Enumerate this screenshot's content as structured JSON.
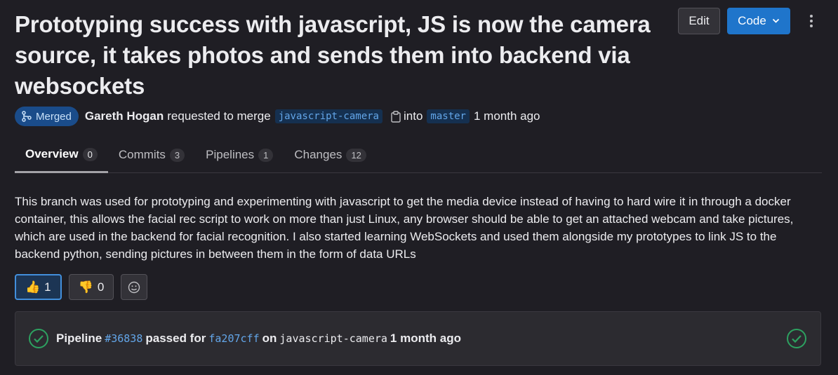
{
  "header": {
    "title": "Prototyping success with javascript, JS is now the camera source, it takes photos and sends them into backend via websockets",
    "edit_label": "Edit",
    "code_label": "Code"
  },
  "meta": {
    "status": "Merged",
    "author": "Gareth Hogan",
    "action_text": "requested to merge",
    "source_branch": "javascript-camera",
    "into_text": "into",
    "target_branch": "master",
    "time": "1 month ago"
  },
  "tabs": [
    {
      "label": "Overview",
      "count": "0",
      "active": true
    },
    {
      "label": "Commits",
      "count": "3"
    },
    {
      "label": "Pipelines",
      "count": "1"
    },
    {
      "label": "Changes",
      "count": "12"
    }
  ],
  "description": "This branch was used for prototyping and experimenting with javascript to get the media device instead of having to hard wire it in through a docker container, this allows the facial rec script to work on more than just Linux, any browser should be able to get an attached webcam and take pictures, which are used in the backend for facial recognition. I also started learning WebSockets and used them alongside my prototypes to link JS to the backend python, sending pictures in between them in the form of data URLs",
  "reactions": {
    "thumbs_up": "1",
    "thumbs_down": "0",
    "thumbs_up_icon": "👍",
    "thumbs_down_icon": "👎"
  },
  "pipeline": {
    "label": "Pipeline",
    "id": "#36838",
    "passed_text": "passed for",
    "commit": "fa207cff",
    "on_text": "on",
    "branch": "javascript-camera",
    "time": "1 month ago",
    "status_color": "#2da160"
  },
  "colors": {
    "background": "#1f1e24",
    "accent": "#1f75cb",
    "link": "#63a6e9",
    "success": "#2da160"
  }
}
